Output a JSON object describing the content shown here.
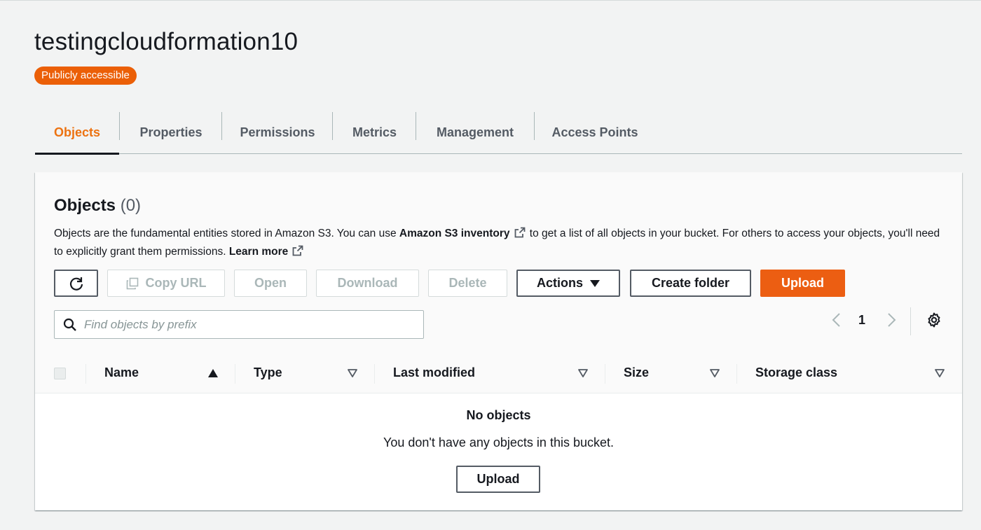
{
  "bucket": {
    "name": "testingcloudformation10",
    "access_badge": "Publicly accessible"
  },
  "tabs": [
    {
      "label": "Objects",
      "active": true
    },
    {
      "label": "Properties",
      "active": false
    },
    {
      "label": "Permissions",
      "active": false
    },
    {
      "label": "Metrics",
      "active": false
    },
    {
      "label": "Management",
      "active": false
    },
    {
      "label": "Access Points",
      "active": false
    }
  ],
  "objects_panel": {
    "title": "Objects",
    "count": "(0)",
    "description_part1": "Objects are the fundamental entities stored in Amazon S3. You can use ",
    "inventory_link": "Amazon S3 inventory",
    "description_part2": " to get a list of all objects in your bucket. For others to access your objects, you'll need to explicitly grant them permissions. ",
    "learn_more": "Learn more"
  },
  "toolbar": {
    "refresh_icon": "refresh-icon",
    "copy_url": "Copy URL",
    "open": "Open",
    "download": "Download",
    "delete": "Delete",
    "actions": "Actions",
    "create_folder": "Create folder",
    "upload": "Upload"
  },
  "search": {
    "placeholder": "Find objects by prefix",
    "value": ""
  },
  "pagination": {
    "current_page": "1"
  },
  "table": {
    "columns": [
      "Name",
      "Type",
      "Last modified",
      "Size",
      "Storage class"
    ],
    "sorted_column": "Name",
    "sort_direction": "ascending",
    "rows": []
  },
  "empty_state": {
    "title": "No objects",
    "message": "You don't have any objects in this bucket.",
    "button": "Upload"
  },
  "colors": {
    "accent": "#ec7211",
    "primary_button": "#ec5e12",
    "badge": "#eb5f07",
    "text": "#16191f",
    "muted": "#545b64",
    "disabled": "#aab7b8"
  }
}
